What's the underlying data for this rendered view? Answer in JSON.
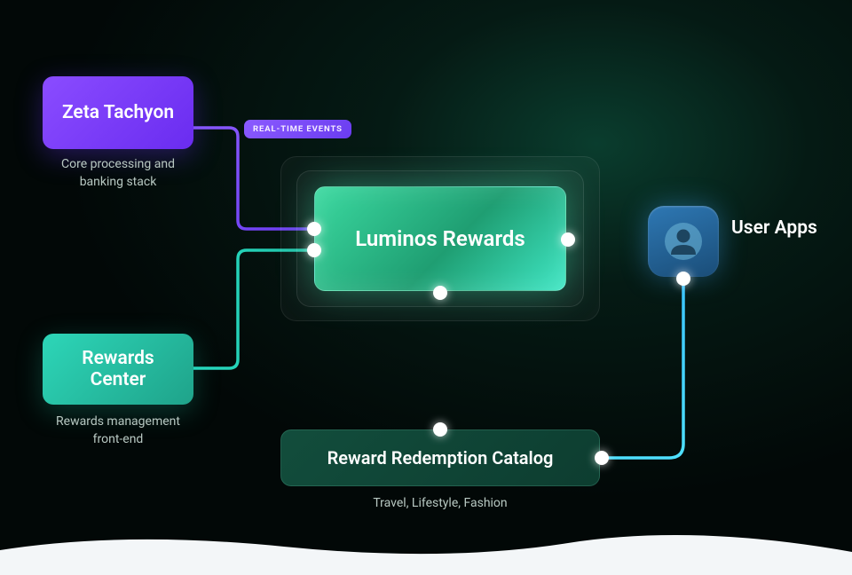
{
  "zeta": {
    "title": "Zeta Tachyon",
    "subtitle": "Core processing and banking stack"
  },
  "rewards_center": {
    "title": "Rewards Center",
    "subtitle": "Rewards management front-end"
  },
  "luminos": {
    "title": "Luminos Rewards"
  },
  "catalog": {
    "title": "Reward Redemption Catalog",
    "subtitle": "Travel, Lifestyle, Fashion"
  },
  "badge": {
    "label": "REAL-TIME EVENTS"
  },
  "user_apps": {
    "label": "User Apps"
  }
}
